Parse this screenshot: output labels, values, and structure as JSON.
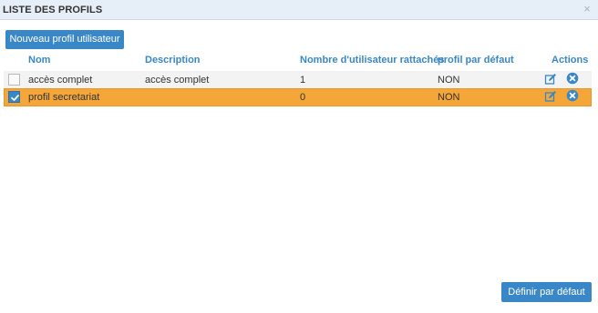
{
  "dialog": {
    "title": "LISTE DES PROFILS",
    "close_glyph": "×"
  },
  "toolbar": {
    "new_profile_label": "Nouveau profil utilisateur"
  },
  "table": {
    "columns": [
      "Nom",
      "Description",
      "Nombre d'utilisateur rattachés",
      "profil par défaut",
      "Actions"
    ],
    "rows": [
      {
        "checked": false,
        "nom": "accès complet",
        "description": "accès complet",
        "nombre": "1",
        "defaut": "NON"
      },
      {
        "checked": true,
        "nom": "profil secretariat",
        "description": "",
        "nombre": "0",
        "defaut": "NON"
      }
    ]
  },
  "footer": {
    "set_default_label": "Définir par défaut"
  },
  "colors": {
    "accent": "#3a87c7",
    "selected_row": "#f4a738",
    "title_bar": "#e6eef7"
  },
  "icons": {
    "edit": "edit-icon",
    "delete": "delete-icon",
    "close": "close-icon",
    "check": "check-icon"
  }
}
